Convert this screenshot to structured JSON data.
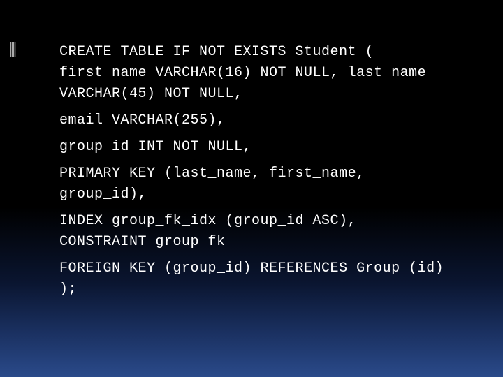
{
  "slide": {
    "lines": [
      "CREATE TABLE IF NOT EXISTS Student ( first_name VARCHAR(16) NOT NULL, last_name VARCHAR(45) NOT NULL,",
      "email VARCHAR(255),",
      "group_id INT NOT NULL,",
      "PRIMARY KEY (last_name, first_name, group_id),",
      "INDEX group_fk_idx (group_id ASC), CONSTRAINT group_fk",
      "FOREIGN KEY (group_id) REFERENCES Group (id) );"
    ]
  }
}
